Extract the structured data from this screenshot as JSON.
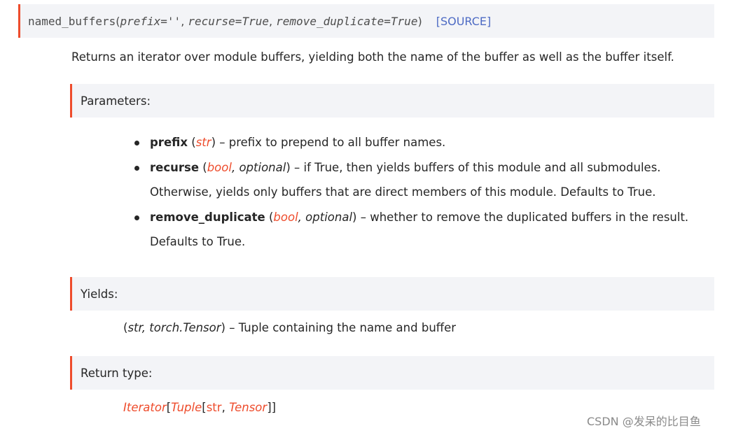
{
  "signature": {
    "name": "named_buffers",
    "open_paren": "(",
    "p1": "prefix=''",
    "sep1": ",",
    "p2": "recurse=True",
    "sep2": ",",
    "p3": "remove_duplicate=True",
    "close_paren": ")",
    "source_link": "[SOURCE]"
  },
  "description": "Returns an iterator over module buffers, yielding both the name of the buffer as well as the buffer itself.",
  "parameters": {
    "heading": "Parameters:",
    "items": [
      {
        "name": "prefix",
        "type_open": " (",
        "type1": "str",
        "type_close": ")",
        "desc": " – prefix to prepend to all buffer names."
      },
      {
        "name": "recurse",
        "type_open": " (",
        "type1": "bool",
        "type_sep": ", ",
        "type2": "optional",
        "type_close": ")",
        "desc": " – if True, then yields buffers of this module and all submodules. Otherwise, yields only buffers that are direct members of this module. Defaults to True."
      },
      {
        "name": "remove_duplicate",
        "type_open": " (",
        "type1": "bool",
        "type_sep": ", ",
        "type2": "optional",
        "type_close": ")",
        "desc": " – whether to remove the duplicated buffers in the result. Defaults to True."
      }
    ]
  },
  "yields": {
    "heading": "Yields:",
    "open": "(",
    "t1": "str",
    "sep": ", ",
    "t2": "torch.Tensor",
    "close": ")",
    "desc": " – Tuple containing the name and buffer"
  },
  "return_type": {
    "heading": "Return type:",
    "t1": "Iterator",
    "b1": "[",
    "t2": "Tuple",
    "b2": "[",
    "t3": "str",
    "sep": ", ",
    "t4": "Tensor",
    "b3": "]]"
  },
  "watermark": "CSDN @发呆的比目鱼"
}
